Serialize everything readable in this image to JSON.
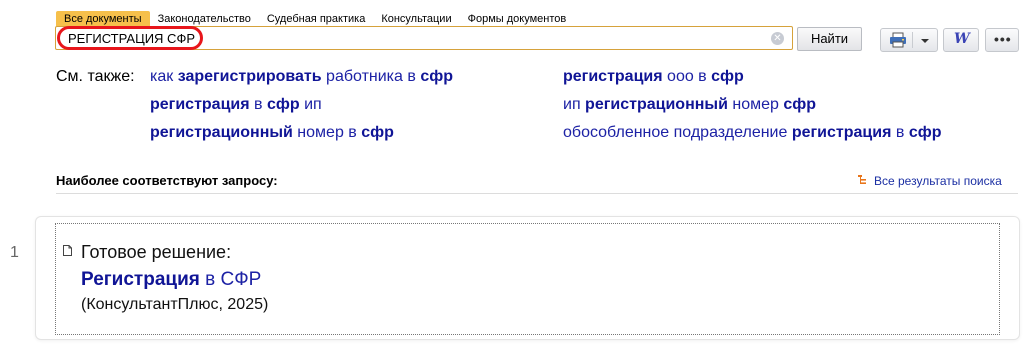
{
  "tabs": [
    {
      "label": "Все документы",
      "active": true
    },
    {
      "label": "Законодательство",
      "active": false
    },
    {
      "label": "Судебная практика",
      "active": false
    },
    {
      "label": "Консультации",
      "active": false
    },
    {
      "label": "Формы документов",
      "active": false
    }
  ],
  "search": {
    "value": "РЕГИСТРАЦИЯ СФР",
    "button_label": "Найти"
  },
  "toolbar": {
    "print_icon": "printer-icon",
    "word_icon": "word-export-icon",
    "more_icon": "ellipsis-icon",
    "word_glyph": "W",
    "more_glyph": "•••"
  },
  "see_also": {
    "label": "См. также:",
    "links": [
      {
        "parts": [
          {
            "t": "как ",
            "b": false
          },
          {
            "t": "зарегистрировать",
            "b": true
          },
          {
            "t": " работника в ",
            "b": false
          },
          {
            "t": "сфр",
            "b": true
          }
        ]
      },
      {
        "parts": [
          {
            "t": "регистрация",
            "b": true
          },
          {
            "t": " ооо в ",
            "b": false
          },
          {
            "t": "сфр",
            "b": true
          }
        ]
      },
      {
        "parts": [
          {
            "t": "регистрация",
            "b": true
          },
          {
            "t": " в ",
            "b": false
          },
          {
            "t": "сфр",
            "b": true
          },
          {
            "t": " ип",
            "b": false
          }
        ]
      },
      {
        "parts": [
          {
            "t": "ип ",
            "b": false
          },
          {
            "t": "регистрационный",
            "b": true
          },
          {
            "t": " номер ",
            "b": false
          },
          {
            "t": "сфр",
            "b": true
          }
        ]
      },
      {
        "parts": [
          {
            "t": "регистрационный",
            "b": true
          },
          {
            "t": " номер в ",
            "b": false
          },
          {
            "t": "сфр",
            "b": true
          }
        ]
      },
      {
        "parts": [
          {
            "t": "обособленное подразделение ",
            "b": false
          },
          {
            "t": "регистрация",
            "b": true
          },
          {
            "t": " в ",
            "b": false
          },
          {
            "t": "сфр",
            "b": true
          }
        ]
      }
    ]
  },
  "results": {
    "header": "Наиболее соответствуют запросу:",
    "all_results_label": "Все результаты поиска",
    "items": [
      {
        "rank": "1",
        "type_label": "Готовое решение:",
        "title_parts": [
          {
            "t": "Регистрация",
            "b": true
          },
          {
            "t": " в ",
            "b": false
          },
          {
            "t": "СФР",
            "b": false
          }
        ],
        "source": "(КонсультантПлюс, 2025)"
      }
    ]
  },
  "colors": {
    "accent_tab": "#f6c04b",
    "link": "#1d22a5",
    "highlight_oval": "#e8161b"
  }
}
